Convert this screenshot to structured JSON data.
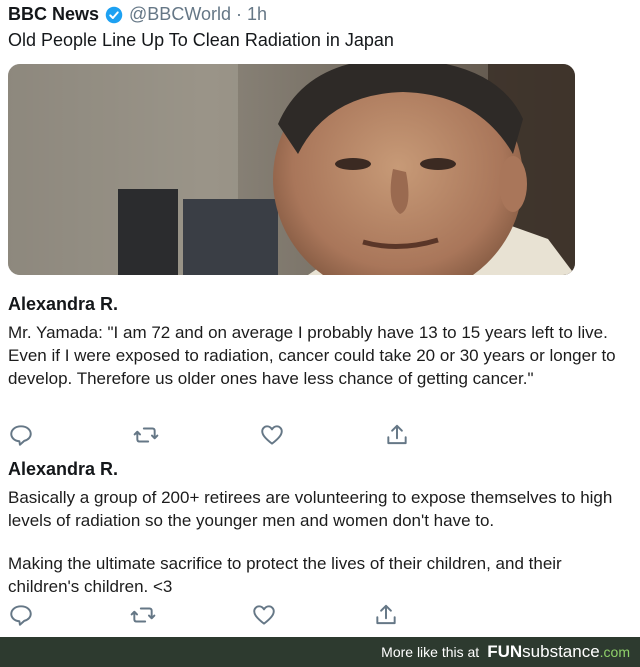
{
  "tweet": {
    "author": "BBC News",
    "handle_time": "@BBCWorld · 1h",
    "text": "Old People Line Up To Clean Radiation in Japan",
    "media_icon": "photo-of-elderly-man"
  },
  "replies": [
    {
      "name": "Alexandra R.",
      "paragraphs": [
        "Mr. Yamada: \"I am 72 and on average I probably have 13 to 15 years left to live. Even if I were exposed to radiation, cancer could take 20 or 30 years or longer to develop. Therefore us older ones have less chance of getting cancer.\""
      ]
    },
    {
      "name": "Alexandra R.",
      "paragraphs": [
        "Basically a group of 200+ retirees are volunteering to expose themselves to high levels of radiation so the younger men and women don't have to.",
        "Making the ultimate sacrifice to protect the lives of their children, and their children's children. <3"
      ]
    }
  ],
  "actions": {
    "icons": [
      "comment-icon",
      "retweet-icon",
      "like-icon",
      "share-icon"
    ]
  },
  "footer": {
    "text": "More like this at",
    "brand_fun": "FUN",
    "brand_sub": "substance",
    "brand_com": ".com"
  },
  "colors": {
    "verified": "#1da1f2",
    "icon_gray": "#657786",
    "footer_bg": "#2d3a2f",
    "brand_accent": "#8fd16a"
  }
}
